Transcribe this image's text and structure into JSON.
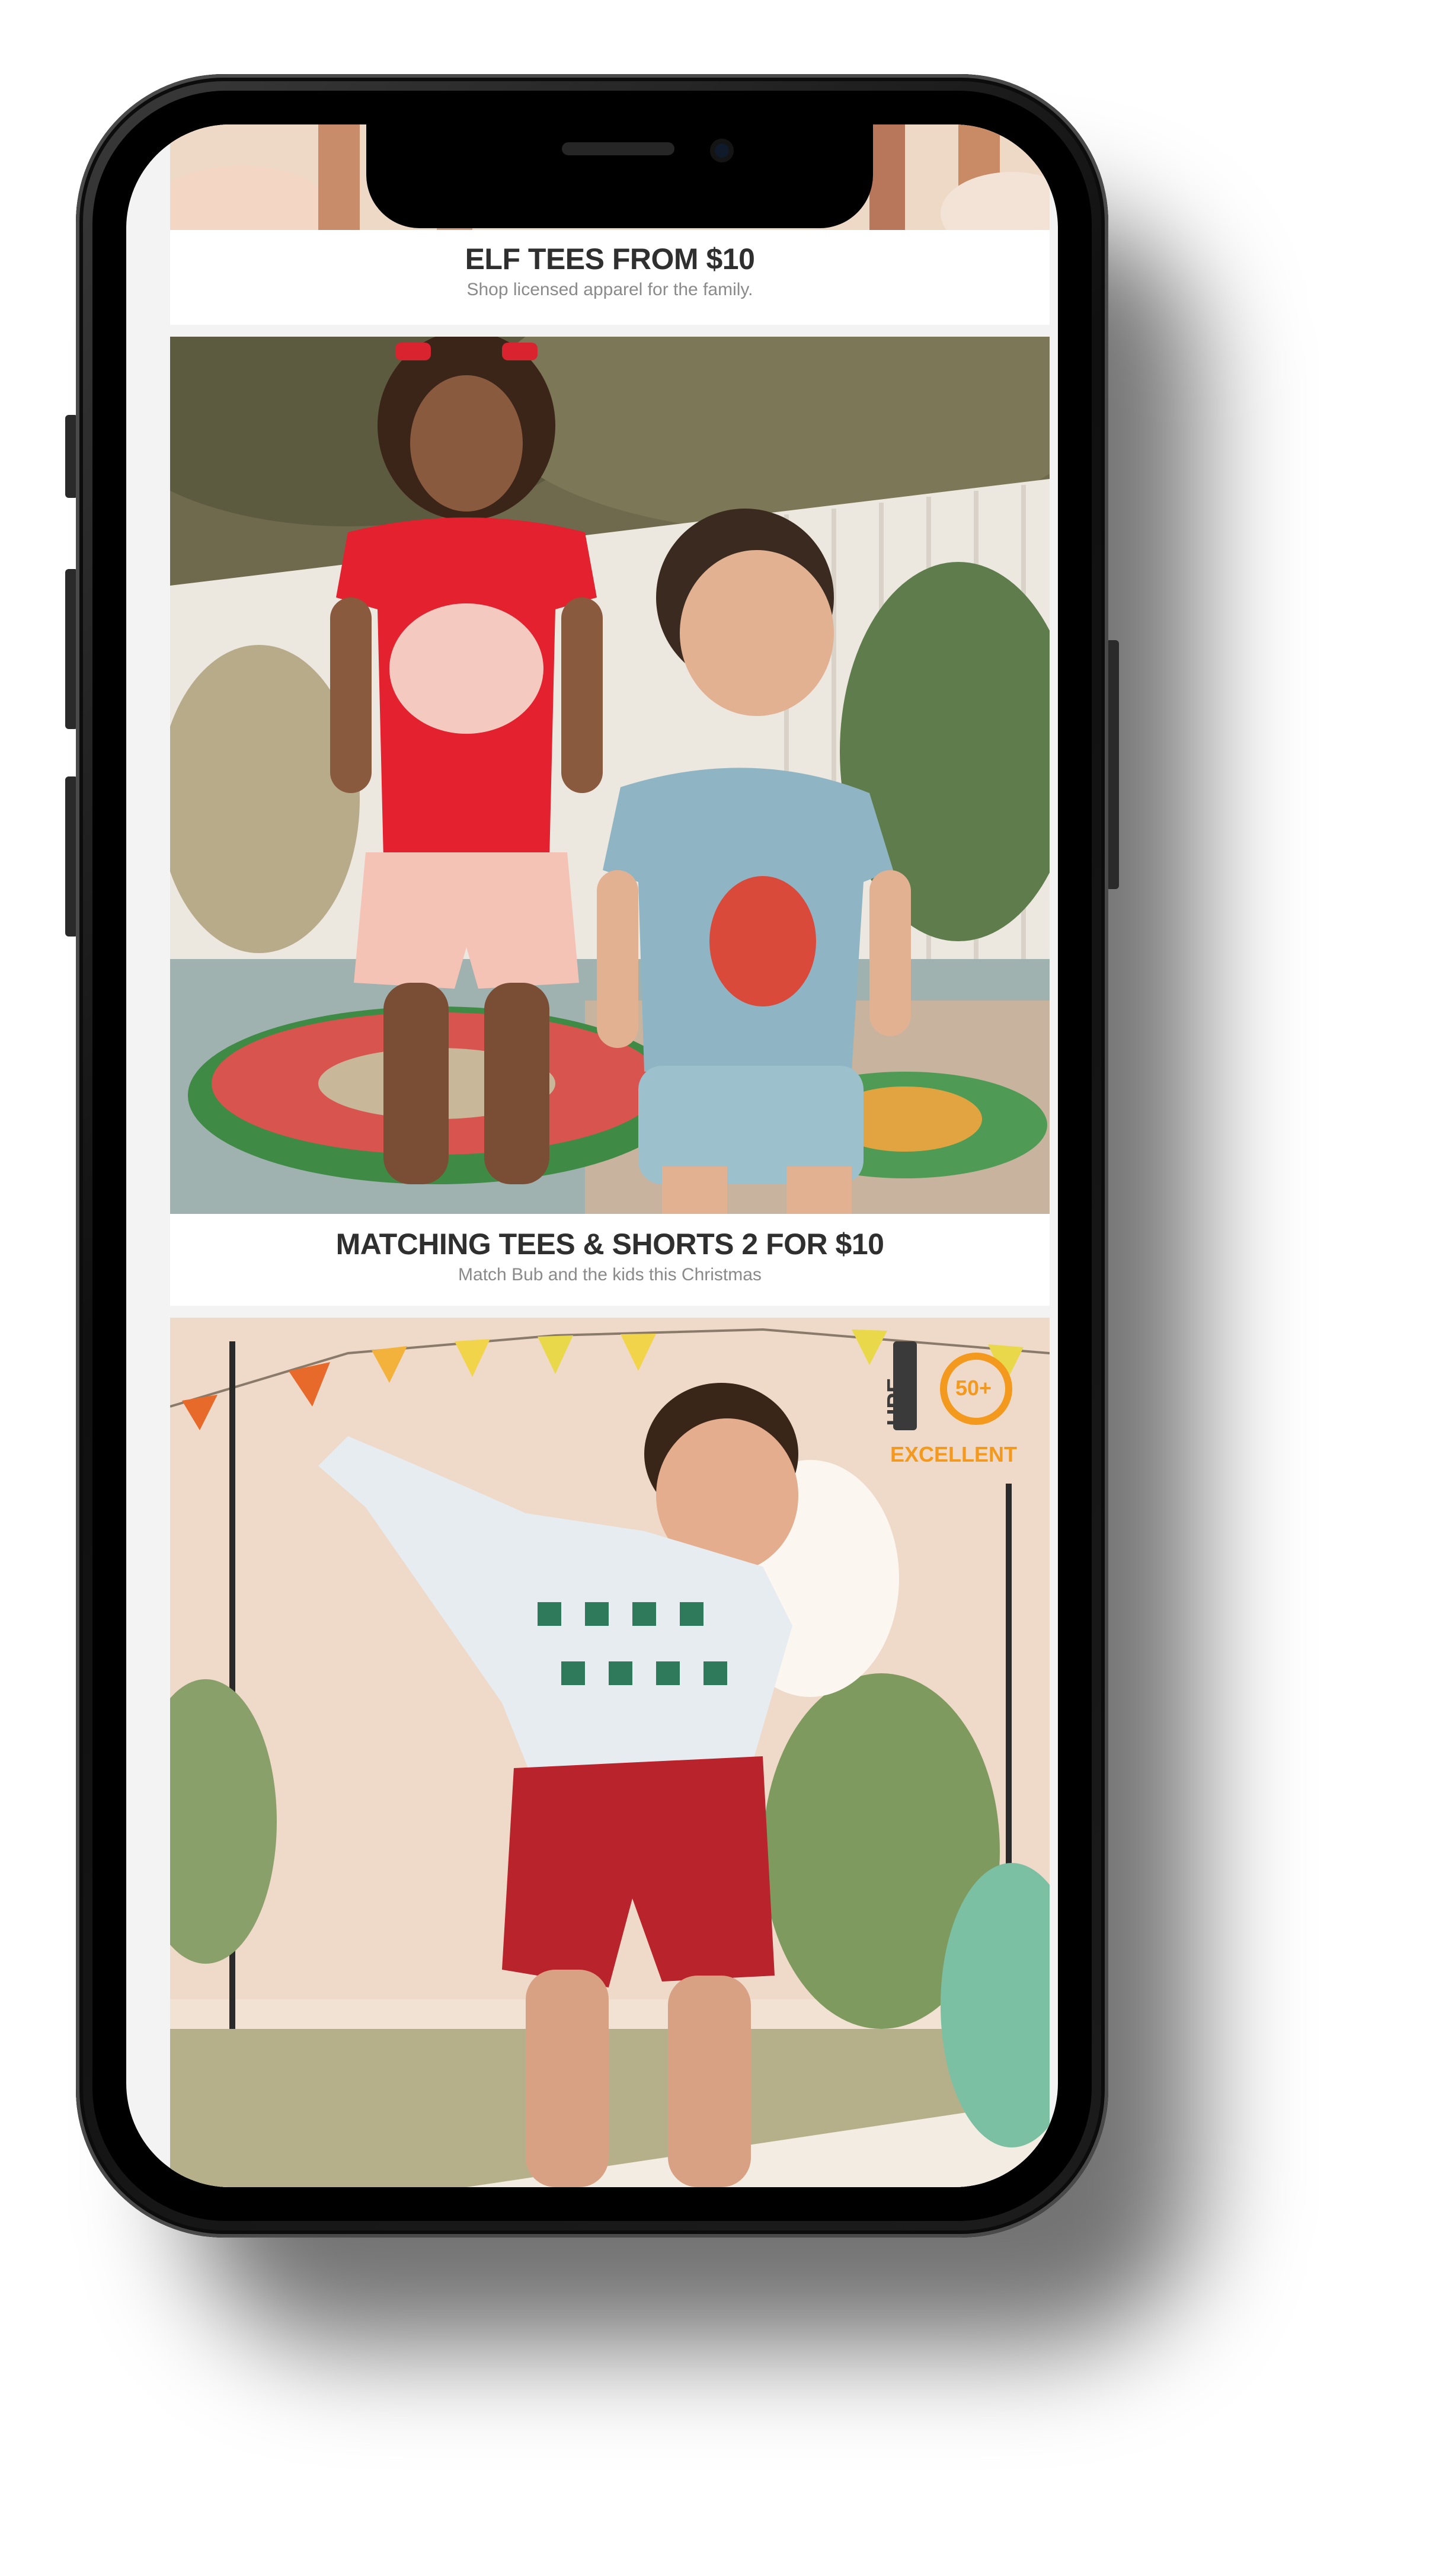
{
  "feed": {
    "cards": [
      {
        "title": "ELF TEES FROM $10",
        "subtitle": "Shop licensed apparel for the family."
      },
      {
        "title": "MATCHING TEES & SHORTS 2 FOR $10",
        "subtitle": "Match Bub and the kids this Christmas"
      }
    ],
    "badge": {
      "upf_label": "UPF",
      "rating": "50+",
      "rating_text": "EXCELLENT"
    }
  },
  "colors": {
    "caption_bg": "#ffffff",
    "title_text": "#2f2f2f",
    "subtitle_text": "#8a8a8a",
    "badge_orange": "#f39a1e"
  }
}
